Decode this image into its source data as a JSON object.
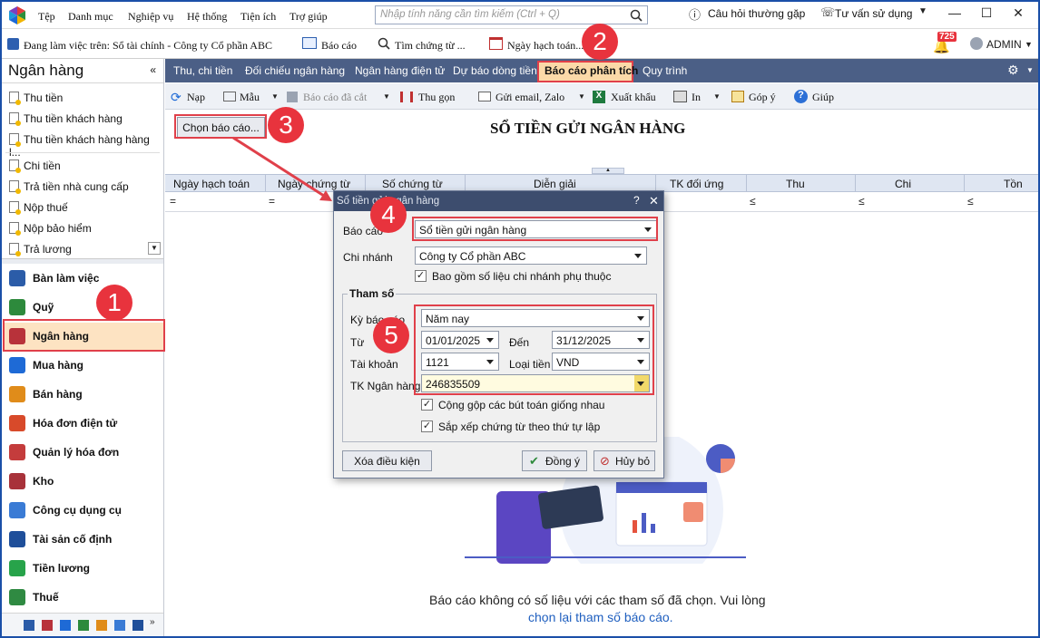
{
  "menubar": {
    "items": [
      "Tệp",
      "Danh mục",
      "Nghiệp vụ",
      "Hệ thống",
      "Tiện ích",
      "Trợ giúp"
    ],
    "search_placeholder": "Nhập tính năng cần tìm kiếm (Ctrl + Q)",
    "faq": "Câu hỏi thường gặp",
    "consult": "Tư vấn sử dụng"
  },
  "toolbar2": {
    "workspace": "Đang làm việc trên: Sổ tài chính - Công ty Cổ phần ABC",
    "report": "Báo cáo",
    "find_doc": "Tìm chứng từ ...",
    "post_date": "Ngày hạch toán...",
    "notif_count": "725",
    "user": "ADMIN"
  },
  "left": {
    "title": "Ngân hàng",
    "subitems": [
      "Thu tiền",
      "Thu tiền khách hàng",
      "Thu tiền khách hàng hàng l...",
      "Chi tiền",
      "Trả tiền nhà cung cấp",
      "Nộp thuế",
      "Nộp bảo hiểm",
      "Trả lương"
    ],
    "nav": [
      "Bàn làm việc",
      "Quỹ",
      "Ngân hàng",
      "Mua hàng",
      "Bán hàng",
      "Hóa đơn điện tử",
      "Quản lý hóa đơn",
      "Kho",
      "Công cụ dụng cụ",
      "Tài sản cố định",
      "Tiền lương",
      "Thuế"
    ]
  },
  "tabs": [
    "Thu, chi tiền",
    "Đối chiếu ngân hàng",
    "Ngân hàng điện tử",
    "Dự báo dòng tiền",
    "Báo cáo phân tích",
    "Quy trình"
  ],
  "toolbar3": {
    "reload": "Nạp",
    "template": "Mẫu",
    "saved": "Báo cáo đã cắt",
    "collapse": "Thu gọn",
    "send": "Gửi email, Zalo",
    "export": "Xuất khẩu",
    "print": "In",
    "feedback": "Góp ý",
    "help": "Giúp"
  },
  "report": {
    "choose": "Chọn báo cáo...",
    "title": "SỔ TIỀN GỬI NGÂN HÀNG",
    "columns": [
      "Ngày hạch toán",
      "Ngày chứng từ",
      "Số chứng từ",
      "Diễn giải",
      "TK đối ứng",
      "Thu",
      "Chi",
      "Tồn"
    ],
    "empty1": "Báo cáo không có số liệu với các tham số đã chọn. Vui lòng",
    "empty2": "chọn lại tham số báo cáo."
  },
  "dialog": {
    "title": "Sổ tiền gửi ngân hàng",
    "help": "?",
    "report_label": "Báo cáo",
    "report_value": "Sổ tiền gửi ngân hàng",
    "branch_label": "Chi nhánh",
    "branch_value": "Công ty Cổ phần ABC",
    "include_branch": "Bao gồm số liệu chi nhánh phụ thuộc",
    "params": "Tham số",
    "period_label": "Kỳ báo cáo",
    "period_value": "Năm nay",
    "from_label": "Từ",
    "from_value": "01/01/2025",
    "to_label": "Đến",
    "to_value": "31/12/2025",
    "account_label": "Tài khoản",
    "account_value": "1121",
    "currency_label": "Loại tiền",
    "currency_value": "VND",
    "bank_label": "TK Ngân hàng",
    "bank_value": "246835509",
    "merge": "Cộng gộp các bút toán giống nhau",
    "sort": "Sắp xếp chứng từ theo thứ tự lập",
    "clear": "Xóa điều kiện",
    "ok": "Đồng ý",
    "cancel": "Hủy bỏ"
  },
  "badges": [
    "1",
    "2",
    "3",
    "4",
    "5"
  ],
  "colors": {
    "accent": "#e8333d",
    "tabbar": "#4b5f86",
    "header": "#dfe6f2"
  }
}
